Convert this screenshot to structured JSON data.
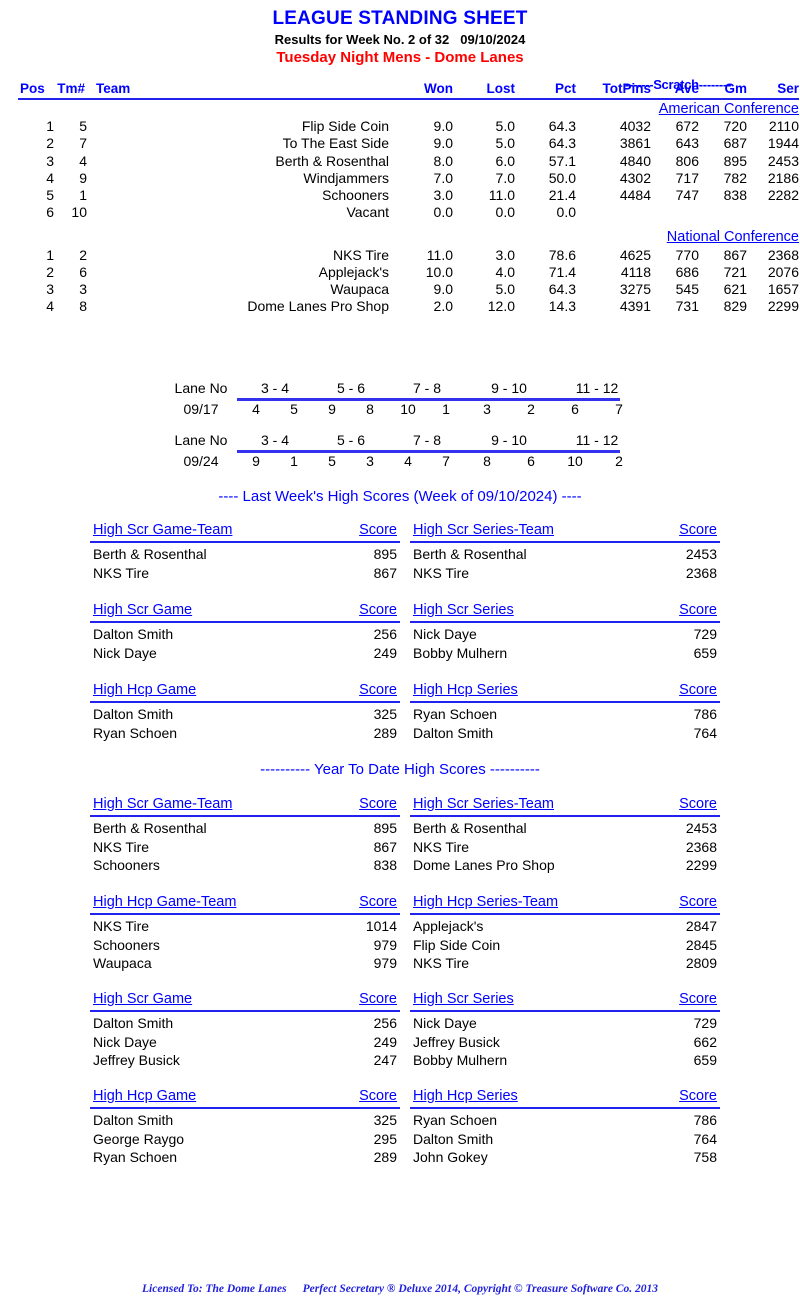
{
  "header": {
    "title": "LEAGUE STANDING SHEET",
    "results_line_prefix": "Results for Week No. 2 of 32",
    "results_line_date": "09/10/2024",
    "league_name": "Tuesday Night Mens - Dome Lanes"
  },
  "standings": {
    "scratch_label": "-------Scratch--------",
    "columns": {
      "pos": "Pos",
      "tm": "Tm#",
      "team": "Team",
      "won": "Won",
      "lost": "Lost",
      "pct": "Pct",
      "totpins": "TotPins",
      "ave": "Ave",
      "gm": "Gm",
      "ser": "Ser"
    },
    "conferences": [
      {
        "name": "American Conference",
        "rows": [
          {
            "pos": "1",
            "tm": "5",
            "team": "Flip Side Coin",
            "won": "9.0",
            "lost": "5.0",
            "pct": "64.3",
            "totpins": "4032",
            "ave": "672",
            "gm": "720",
            "ser": "2110"
          },
          {
            "pos": "2",
            "tm": "7",
            "team": "To The East Side",
            "won": "9.0",
            "lost": "5.0",
            "pct": "64.3",
            "totpins": "3861",
            "ave": "643",
            "gm": "687",
            "ser": "1944"
          },
          {
            "pos": "3",
            "tm": "4",
            "team": "Berth & Rosenthal",
            "won": "8.0",
            "lost": "6.0",
            "pct": "57.1",
            "totpins": "4840",
            "ave": "806",
            "gm": "895",
            "ser": "2453"
          },
          {
            "pos": "4",
            "tm": "9",
            "team": "Windjammers",
            "won": "7.0",
            "lost": "7.0",
            "pct": "50.0",
            "totpins": "4302",
            "ave": "717",
            "gm": "782",
            "ser": "2186"
          },
          {
            "pos": "5",
            "tm": "1",
            "team": "Schooners",
            "won": "3.0",
            "lost": "11.0",
            "pct": "21.4",
            "totpins": "4484",
            "ave": "747",
            "gm": "838",
            "ser": "2282"
          },
          {
            "pos": "6",
            "tm": "10",
            "team": "Vacant",
            "won": "0.0",
            "lost": "0.0",
            "pct": "0.0",
            "totpins": "",
            "ave": "",
            "gm": "",
            "ser": ""
          }
        ]
      },
      {
        "name": "National Conference",
        "rows": [
          {
            "pos": "1",
            "tm": "2",
            "team": "NKS Tire",
            "won": "11.0",
            "lost": "3.0",
            "pct": "78.6",
            "totpins": "4625",
            "ave": "770",
            "gm": "867",
            "ser": "2368"
          },
          {
            "pos": "2",
            "tm": "6",
            "team": "Applejack's",
            "won": "10.0",
            "lost": "4.0",
            "pct": "71.4",
            "totpins": "4118",
            "ave": "686",
            "gm": "721",
            "ser": "2076"
          },
          {
            "pos": "3",
            "tm": "3",
            "team": "Waupaca",
            "won": "9.0",
            "lost": "5.0",
            "pct": "64.3",
            "totpins": "3275",
            "ave": "545",
            "gm": "621",
            "ser": "1657"
          },
          {
            "pos": "4",
            "tm": "8",
            "team": "Dome Lanes Pro Shop",
            "won": "2.0",
            "lost": "12.0",
            "pct": "14.3",
            "totpins": "4391",
            "ave": "731",
            "gm": "829",
            "ser": "2299"
          }
        ]
      }
    ]
  },
  "lane_schedule": {
    "row_label": "Lane No",
    "lane_pairs": [
      "3 - 4",
      "5 - 6",
      "7 - 8",
      "9 - 10",
      "11 - 12"
    ],
    "weeks": [
      {
        "date": "09/17",
        "teams": [
          "4",
          "5",
          "9",
          "8",
          "10",
          "1",
          "3",
          "2",
          "6",
          "7"
        ]
      },
      {
        "date": "09/24",
        "teams": [
          "9",
          "1",
          "5",
          "3",
          "4",
          "7",
          "8",
          "6",
          "10",
          "2"
        ]
      }
    ]
  },
  "last_week": {
    "heading": "----  Last Week's High Scores   (Week of 09/10/2024)  ----",
    "blocks": [
      {
        "left": {
          "title": "High Scr Game-Team",
          "score_header": "Score",
          "rows": [
            {
              "name": "Berth & Rosenthal",
              "score": "895"
            },
            {
              "name": "NKS Tire",
              "score": "867"
            }
          ]
        },
        "right": {
          "title": "High Scr Series-Team",
          "score_header": "Score",
          "rows": [
            {
              "name": "Berth & Rosenthal",
              "score": "2453"
            },
            {
              "name": "NKS Tire",
              "score": "2368"
            }
          ]
        }
      },
      {
        "left": {
          "title": "High Scr Game",
          "score_header": "Score",
          "rows": [
            {
              "name": "Dalton Smith",
              "score": "256"
            },
            {
              "name": "Nick Daye",
              "score": "249"
            }
          ]
        },
        "right": {
          "title": "High Scr Series",
          "score_header": "Score",
          "rows": [
            {
              "name": "Nick Daye",
              "score": "729"
            },
            {
              "name": "Bobby Mulhern",
              "score": "659"
            }
          ]
        }
      },
      {
        "left": {
          "title": "High Hcp Game",
          "score_header": "Score",
          "rows": [
            {
              "name": "Dalton Smith",
              "score": "325"
            },
            {
              "name": "Ryan Schoen",
              "score": "289"
            }
          ]
        },
        "right": {
          "title": "High Hcp Series",
          "score_header": "Score",
          "rows": [
            {
              "name": "Ryan Schoen",
              "score": "786"
            },
            {
              "name": "Dalton Smith",
              "score": "764"
            }
          ]
        }
      }
    ]
  },
  "year_to_date": {
    "heading": "---------- Year To Date High Scores ----------",
    "blocks": [
      {
        "left": {
          "title": "High Scr Game-Team",
          "score_header": "Score",
          "rows": [
            {
              "name": "Berth & Rosenthal",
              "score": "895"
            },
            {
              "name": "NKS Tire",
              "score": "867"
            },
            {
              "name": "Schooners",
              "score": "838"
            }
          ]
        },
        "right": {
          "title": "High Scr Series-Team",
          "score_header": "Score",
          "rows": [
            {
              "name": "Berth & Rosenthal",
              "score": "2453"
            },
            {
              "name": "NKS Tire",
              "score": "2368"
            },
            {
              "name": "Dome Lanes Pro Shop",
              "score": "2299"
            }
          ]
        }
      },
      {
        "left": {
          "title": "High Hcp Game-Team",
          "score_header": "Score",
          "rows": [
            {
              "name": "NKS Tire",
              "score": "1014"
            },
            {
              "name": "Schooners",
              "score": "979"
            },
            {
              "name": "Waupaca",
              "score": "979"
            }
          ]
        },
        "right": {
          "title": "High Hcp Series-Team",
          "score_header": "Score",
          "rows": [
            {
              "name": "Applejack's",
              "score": "2847"
            },
            {
              "name": "Flip Side Coin",
              "score": "2845"
            },
            {
              "name": "NKS Tire",
              "score": "2809"
            }
          ]
        }
      },
      {
        "left": {
          "title": "High Scr Game",
          "score_header": "Score",
          "rows": [
            {
              "name": "Dalton Smith",
              "score": "256"
            },
            {
              "name": "Nick Daye",
              "score": "249"
            },
            {
              "name": "Jeffrey Busick",
              "score": "247"
            }
          ]
        },
        "right": {
          "title": "High Scr Series",
          "score_header": "Score",
          "rows": [
            {
              "name": "Nick Daye",
              "score": "729"
            },
            {
              "name": "Jeffrey Busick",
              "score": "662"
            },
            {
              "name": "Bobby Mulhern",
              "score": "659"
            }
          ]
        }
      },
      {
        "left": {
          "title": "High Hcp Game",
          "score_header": "Score",
          "rows": [
            {
              "name": "Dalton Smith",
              "score": "325"
            },
            {
              "name": "George Raygo",
              "score": "295"
            },
            {
              "name": "Ryan Schoen",
              "score": "289"
            }
          ]
        },
        "right": {
          "title": "High Hcp Series",
          "score_header": "Score",
          "rows": [
            {
              "name": "Ryan Schoen",
              "score": "786"
            },
            {
              "name": "Dalton Smith",
              "score": "764"
            },
            {
              "name": "John Gokey",
              "score": "758"
            }
          ]
        }
      }
    ]
  },
  "footer": {
    "licensed_to": "Licensed To: The Dome Lanes",
    "copyright": "Perfect Secretary ® Deluxe  2014, Copyright © Treasure Software Co. 2013"
  },
  "colors": {
    "title_blue": "#0000FF",
    "league_red": "#FF0000",
    "rule_blue": "#2222EE",
    "footer_blue": "#2222DD",
    "text_black": "#000000"
  }
}
